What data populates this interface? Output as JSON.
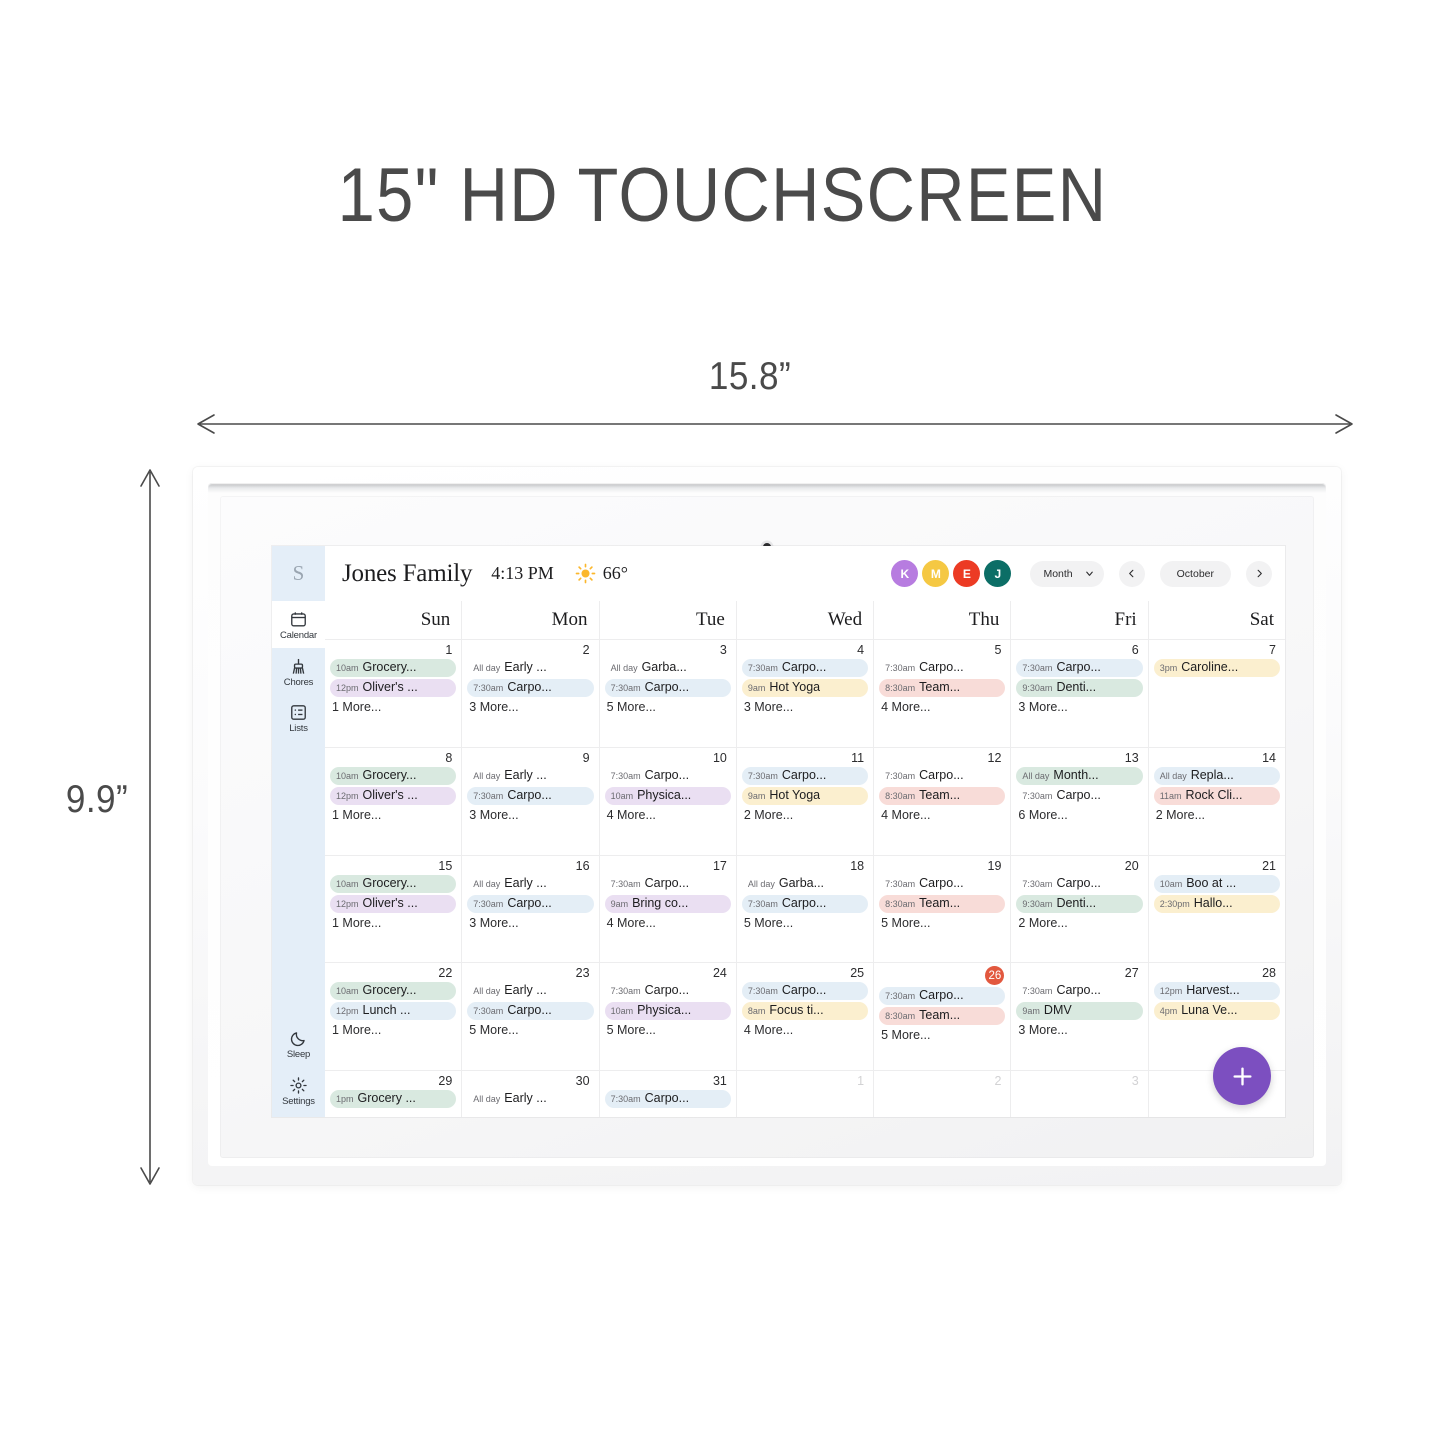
{
  "marketing": {
    "headline": "15\" HD TOUCHSCREEN",
    "width_label": "15.8”",
    "height_label": "9.9”"
  },
  "device": {
    "camera": "camera-dot"
  },
  "sidebar": {
    "logo": "S",
    "items": [
      {
        "label": "Calendar",
        "icon": "calendar-icon",
        "active": true
      },
      {
        "label": "Chores",
        "icon": "broom-icon",
        "active": false
      },
      {
        "label": "Lists",
        "icon": "list-icon",
        "active": false
      }
    ],
    "bottom_items": [
      {
        "label": "Sleep",
        "icon": "moon-icon",
        "active": false
      },
      {
        "label": "Settings",
        "icon": "gear-icon",
        "active": false
      }
    ]
  },
  "topbar": {
    "family_name": "Jones Family",
    "time": "4:13 PM",
    "weather_icon": "sun-icon",
    "temperature": "66°",
    "avatars": [
      {
        "initial": "K",
        "color": "#b77ce0"
      },
      {
        "initial": "M",
        "color": "#f5c843"
      },
      {
        "initial": "E",
        "color": "#ec3b24"
      },
      {
        "initial": "J",
        "color": "#0c6e66"
      }
    ],
    "view_selector": "Month",
    "prev_label": "‹",
    "month_label": "October",
    "next_label": "›",
    "add_label": "+"
  },
  "calendar": {
    "weekdays": [
      "Sun",
      "Mon",
      "Tue",
      "Wed",
      "Thu",
      "Fri",
      "Sat"
    ],
    "today": 26,
    "weeks": [
      [
        {
          "num": "1",
          "muted": false,
          "events": [
            {
              "time": "10am",
              "name": "Grocery...",
              "color": "c-green"
            },
            {
              "time": "12pm",
              "name": "Oliver's ...",
              "color": "c-purple"
            }
          ],
          "more": "1 More..."
        },
        {
          "num": "2",
          "muted": false,
          "events": [
            {
              "time": "All day",
              "name": "Early ...",
              "color": "c-plain"
            },
            {
              "time": "7:30am",
              "name": "Carpo...",
              "color": "c-blue"
            }
          ],
          "more": "3 More..."
        },
        {
          "num": "3",
          "muted": false,
          "events": [
            {
              "time": "All day",
              "name": "Garba...",
              "color": "c-plain"
            },
            {
              "time": "7:30am",
              "name": "Carpo...",
              "color": "c-blue"
            }
          ],
          "more": "5 More..."
        },
        {
          "num": "4",
          "muted": false,
          "events": [
            {
              "time": "7:30am",
              "name": "Carpo...",
              "color": "c-blue"
            },
            {
              "time": "9am",
              "name": "Hot Yoga",
              "color": "c-yellow"
            }
          ],
          "more": "3 More..."
        },
        {
          "num": "5",
          "muted": false,
          "events": [
            {
              "time": "7:30am",
              "name": "Carpo...",
              "color": "c-plain"
            },
            {
              "time": "8:30am",
              "name": "Team...",
              "color": "c-pink"
            }
          ],
          "more": "4 More..."
        },
        {
          "num": "6",
          "muted": false,
          "events": [
            {
              "time": "7:30am",
              "name": "Carpo...",
              "color": "c-blue"
            },
            {
              "time": "9:30am",
              "name": "Denti...",
              "color": "c-green"
            }
          ],
          "more": "3 More..."
        },
        {
          "num": "7",
          "muted": false,
          "events": [
            {
              "time": "3pm",
              "name": "Caroline...",
              "color": "c-yellow"
            }
          ],
          "more": ""
        }
      ],
      [
        {
          "num": "8",
          "muted": false,
          "events": [
            {
              "time": "10am",
              "name": "Grocery...",
              "color": "c-green"
            },
            {
              "time": "12pm",
              "name": "Oliver's ...",
              "color": "c-purple"
            }
          ],
          "more": "1 More..."
        },
        {
          "num": "9",
          "muted": false,
          "events": [
            {
              "time": "All day",
              "name": "Early ...",
              "color": "c-plain"
            },
            {
              "time": "7:30am",
              "name": "Carpo...",
              "color": "c-blue"
            }
          ],
          "more": "3 More..."
        },
        {
          "num": "10",
          "muted": false,
          "events": [
            {
              "time": "7:30am",
              "name": "Carpo...",
              "color": "c-plain"
            },
            {
              "time": "10am",
              "name": "Physica...",
              "color": "c-purple"
            }
          ],
          "more": "4 More..."
        },
        {
          "num": "11",
          "muted": false,
          "events": [
            {
              "time": "7:30am",
              "name": "Carpo...",
              "color": "c-blue"
            },
            {
              "time": "9am",
              "name": "Hot Yoga",
              "color": "c-yellow"
            }
          ],
          "more": "2 More..."
        },
        {
          "num": "12",
          "muted": false,
          "events": [
            {
              "time": "7:30am",
              "name": "Carpo...",
              "color": "c-plain"
            },
            {
              "time": "8:30am",
              "name": "Team...",
              "color": "c-pink"
            }
          ],
          "more": "4 More..."
        },
        {
          "num": "13",
          "muted": false,
          "events": [
            {
              "time": "All day",
              "name": "Month...",
              "color": "c-green"
            },
            {
              "time": "7:30am",
              "name": "Carpo...",
              "color": "c-plain"
            }
          ],
          "more": "6 More..."
        },
        {
          "num": "14",
          "muted": false,
          "events": [
            {
              "time": "All day",
              "name": "Repla...",
              "color": "c-blue"
            },
            {
              "time": "11am",
              "name": "Rock Cli...",
              "color": "c-pink"
            }
          ],
          "more": "2 More..."
        }
      ],
      [
        {
          "num": "15",
          "muted": false,
          "events": [
            {
              "time": "10am",
              "name": "Grocery...",
              "color": "c-green"
            },
            {
              "time": "12pm",
              "name": "Oliver's ...",
              "color": "c-purple"
            }
          ],
          "more": "1 More..."
        },
        {
          "num": "16",
          "muted": false,
          "events": [
            {
              "time": "All day",
              "name": "Early ...",
              "color": "c-plain"
            },
            {
              "time": "7:30am",
              "name": "Carpo...",
              "color": "c-blue"
            }
          ],
          "more": "3 More..."
        },
        {
          "num": "17",
          "muted": false,
          "events": [
            {
              "time": "7:30am",
              "name": "Carpo...",
              "color": "c-plain"
            },
            {
              "time": "9am",
              "name": "Bring co...",
              "color": "c-purple"
            }
          ],
          "more": "4 More..."
        },
        {
          "num": "18",
          "muted": false,
          "events": [
            {
              "time": "All day",
              "name": "Garba...",
              "color": "c-plain"
            },
            {
              "time": "7:30am",
              "name": "Carpo...",
              "color": "c-blue"
            }
          ],
          "more": "5 More..."
        },
        {
          "num": "19",
          "muted": false,
          "events": [
            {
              "time": "7:30am",
              "name": "Carpo...",
              "color": "c-plain"
            },
            {
              "time": "8:30am",
              "name": "Team...",
              "color": "c-pink"
            }
          ],
          "more": "5 More..."
        },
        {
          "num": "20",
          "muted": false,
          "events": [
            {
              "time": "7:30am",
              "name": "Carpo...",
              "color": "c-plain"
            },
            {
              "time": "9:30am",
              "name": "Denti...",
              "color": "c-green"
            }
          ],
          "more": "2 More..."
        },
        {
          "num": "21",
          "muted": false,
          "events": [
            {
              "time": "10am",
              "name": "Boo at ...",
              "color": "c-blue"
            },
            {
              "time": "2:30pm",
              "name": "Hallo...",
              "color": "c-yellow"
            }
          ],
          "more": ""
        }
      ],
      [
        {
          "num": "22",
          "muted": false,
          "events": [
            {
              "time": "10am",
              "name": "Grocery...",
              "color": "c-green"
            },
            {
              "time": "12pm",
              "name": "Lunch ...",
              "color": "c-blue"
            }
          ],
          "more": "1 More..."
        },
        {
          "num": "23",
          "muted": false,
          "events": [
            {
              "time": "All day",
              "name": "Early ...",
              "color": "c-plain"
            },
            {
              "time": "7:30am",
              "name": "Carpo...",
              "color": "c-blue"
            }
          ],
          "more": "5 More..."
        },
        {
          "num": "24",
          "muted": false,
          "events": [
            {
              "time": "7:30am",
              "name": "Carpo...",
              "color": "c-plain"
            },
            {
              "time": "10am",
              "name": "Physica...",
              "color": "c-purple"
            }
          ],
          "more": "5 More..."
        },
        {
          "num": "25",
          "muted": false,
          "events": [
            {
              "time": "7:30am",
              "name": "Carpo...",
              "color": "c-blue"
            },
            {
              "time": "8am",
              "name": "Focus ti...",
              "color": "c-yellow"
            }
          ],
          "more": "4 More..."
        },
        {
          "num": "26",
          "muted": false,
          "today": true,
          "events": [
            {
              "time": "7:30am",
              "name": "Carpo...",
              "color": "c-blue"
            },
            {
              "time": "8:30am",
              "name": "Team...",
              "color": "c-pink"
            }
          ],
          "more": "5 More..."
        },
        {
          "num": "27",
          "muted": false,
          "events": [
            {
              "time": "7:30am",
              "name": "Carpo...",
              "color": "c-plain"
            },
            {
              "time": "9am",
              "name": "DMV",
              "color": "c-green"
            }
          ],
          "more": "3 More..."
        },
        {
          "num": "28",
          "muted": false,
          "events": [
            {
              "time": "12pm",
              "name": "Harvest...",
              "color": "c-blue"
            },
            {
              "time": "4pm",
              "name": "Luna Ve...",
              "color": "c-yellow"
            }
          ],
          "more": ""
        }
      ],
      [
        {
          "num": "29",
          "muted": false,
          "events": [
            {
              "time": "1pm",
              "name": "Grocery ...",
              "color": "c-green"
            }
          ],
          "more": ""
        },
        {
          "num": "30",
          "muted": false,
          "events": [
            {
              "time": "All day",
              "name": "Early ...",
              "color": "c-plain"
            }
          ],
          "more": ""
        },
        {
          "num": "31",
          "muted": false,
          "events": [
            {
              "time": "7:30am",
              "name": "Carpo...",
              "color": "c-blue"
            }
          ],
          "more": ""
        },
        {
          "num": "1",
          "muted": true,
          "events": [],
          "more": ""
        },
        {
          "num": "2",
          "muted": true,
          "events": [],
          "more": ""
        },
        {
          "num": "3",
          "muted": true,
          "events": [],
          "more": ""
        },
        {
          "num": "",
          "muted": true,
          "events": [],
          "more": ""
        }
      ]
    ]
  }
}
